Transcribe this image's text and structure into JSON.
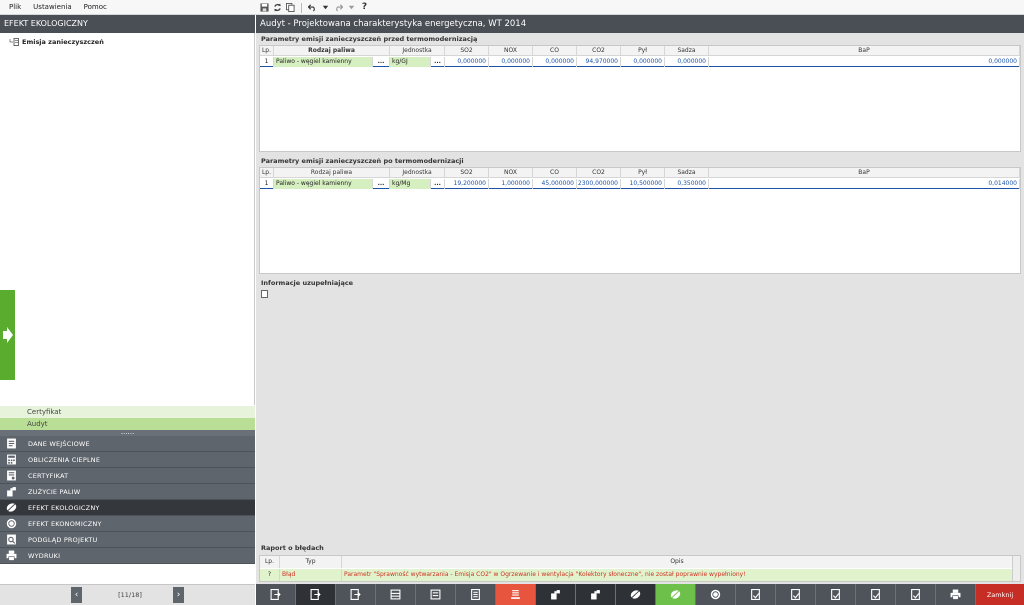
{
  "menu": [
    "Plik",
    "Ustawienia",
    "Pomoc"
  ],
  "left": {
    "title": "EFEKT EKOLOGICZNY",
    "tree_item": "Emisja zanieczyszczeń",
    "sub_items": [
      "Certyfikat",
      "Audyt"
    ],
    "splitter": "......",
    "modules": [
      {
        "label": "DANE WEJŚCIOWE",
        "icon": "document-icon"
      },
      {
        "label": "OBLICZENIA CIEPLNE",
        "icon": "calculator-icon"
      },
      {
        "label": "CERTYFIKAT",
        "icon": "certificate-icon"
      },
      {
        "label": "ZUŻYCIE PALIW",
        "icon": "fuel-icon"
      },
      {
        "label": "EFEKT EKOLOGICZNY",
        "icon": "leaf-icon"
      },
      {
        "label": "EFEKT EKONOMICZNY",
        "icon": "coins-icon"
      },
      {
        "label": "PODGLĄD PROJEKTU",
        "icon": "preview-icon"
      },
      {
        "label": "WYDRUKI",
        "icon": "printer-icon"
      }
    ],
    "pager": "[11/18]"
  },
  "right": {
    "title": "Audyt - Projektowana charakterystyka energetyczna, WT 2014",
    "before": {
      "title": "Parametry emisji zanieczyszczeń przed termomodernizacją",
      "headers": [
        "Lp.",
        "Rodzaj paliwa",
        "Jednostka",
        "SO2",
        "NOX",
        "CO",
        "CO2",
        "Pył",
        "Sadza",
        "BaP"
      ],
      "row": {
        "lp": "1",
        "fuel": "Paliwo - węgiel kamienny",
        "unit": "kg/GJ",
        "so2": "0,000000",
        "nox": "0,000000",
        "co": "0,000000",
        "co2": "94,970000",
        "pyl": "0,000000",
        "sadza": "0,000000",
        "bap": "0,000000"
      }
    },
    "after": {
      "title": "Parametry emisji zanieczyszczeń po termomodernizacji",
      "headers": [
        "Lp.",
        "Rodzaj paliwa",
        "Jednostka",
        "SO2",
        "NOX",
        "CO",
        "CO2",
        "Pył",
        "Sadza",
        "BaP"
      ],
      "row": {
        "lp": "1",
        "fuel": "Paliwo - węgiel kamienny",
        "unit": "kg/Mg",
        "so2": "19,200000",
        "nox": "1,000000",
        "co": "45,000000",
        "co2": "2300,000000",
        "pyl": "10,500000",
        "sadza": "0,350000",
        "bap": "0,014000"
      }
    },
    "info_title": "Informacje uzupełniające",
    "report": {
      "title": "Raport o błędach",
      "headers": [
        "Lp.",
        "Typ",
        "Opis"
      ],
      "row": {
        "lp": "?",
        "typ": "Błąd",
        "opis": "Parametr \"Sprawność wytwarzania - Emisja CO2\" w Ogrzewanie i wentylacja \"Kolektory słoneczne\", nie został poprawnie wypełniony!"
      }
    }
  },
  "actions": {
    "close": "Zamknij"
  },
  "colors": {
    "accent_green": "#6dc04a",
    "header_dark": "#4a4f56",
    "close_red": "#c62d24",
    "error_text": "#d03020"
  }
}
